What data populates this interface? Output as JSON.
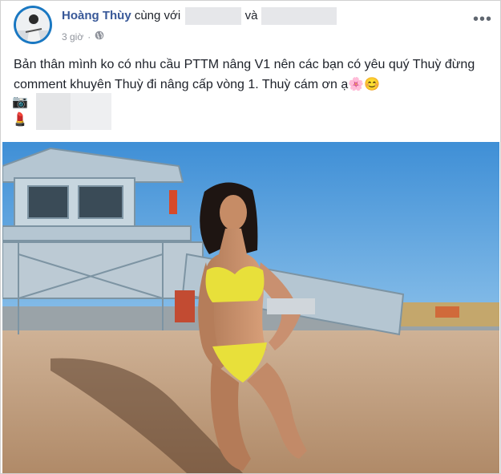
{
  "author": {
    "name": "Hoàng Thùy",
    "with_text": "cùng với",
    "and_text": "và"
  },
  "meta": {
    "time": "3 giờ",
    "separator": "·",
    "privacy_icon": "globe-icon"
  },
  "menu": {
    "more_label": "•••"
  },
  "post": {
    "text": "Bản thân mình ko có nhu cầu PTTM nâng V1 nên các bạn có yêu quý Thuỳ đừng comment khuyên Thuỳ đi nâng cấp vòng 1. Thuỳ cám ơn ạ🌸😊",
    "line1_icon": "📷",
    "line2_icon": "💄"
  },
  "photo": {
    "sky_color": "#5b9fdb",
    "sand_color": "#c9a786",
    "bikini_color": "#e8e03a"
  }
}
